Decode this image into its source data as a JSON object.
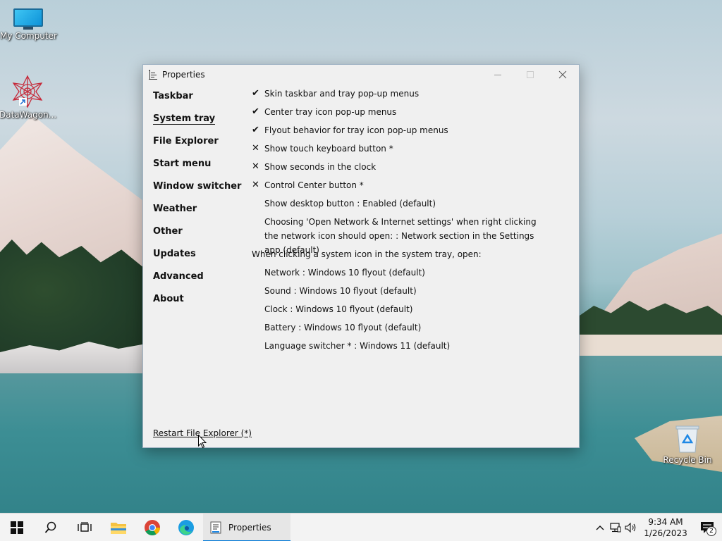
{
  "desktop": {
    "icons": [
      {
        "label": "My Computer"
      },
      {
        "label": "DataWagon..."
      },
      {
        "label": "Recycle Bin"
      }
    ]
  },
  "window": {
    "title": "Properties",
    "nav": [
      "Taskbar",
      "System tray",
      "File Explorer",
      "Start menu",
      "Window switcher",
      "Weather",
      "Other",
      "Updates",
      "Advanced",
      "About"
    ],
    "active_nav": "System tray",
    "options": [
      {
        "mark": "✔",
        "text": "Skin taskbar and tray pop-up menus"
      },
      {
        "mark": "✔",
        "text": "Center tray icon pop-up menus"
      },
      {
        "mark": "✔",
        "text": "Flyout behavior for tray icon pop-up menus"
      },
      {
        "mark": "✕",
        "text": "Show touch keyboard button *"
      },
      {
        "mark": "✕",
        "text": "Show seconds in the clock"
      },
      {
        "mark": "✕",
        "text": "Control Center button *"
      },
      {
        "mark": "",
        "text": "Show desktop button : Enabled (default)"
      },
      {
        "mark": "",
        "text": "Choosing 'Open Network & Internet settings' when right clicking the network icon should open: : Network section in the Settings app (default)"
      }
    ],
    "system_icon_header": "When clicking a system icon in the system tray, open:",
    "system_icon_options": [
      "Network : Windows 10 flyout (default)",
      "Sound : Windows 10 flyout (default)",
      "Clock : Windows 10 flyout (default)",
      "Battery : Windows 10 flyout (default)",
      "Language switcher * : Windows 11 (default)"
    ],
    "restart_link": "Restart File Explorer (*)"
  },
  "taskbar": {
    "app_label": "Properties",
    "time": "9:34 AM",
    "date": "1/26/2023",
    "notification_count": "2"
  },
  "colors": {
    "accent": "#0078d7",
    "window_bg": "#f0f0f0",
    "taskbar_bg": "#f3f3f3"
  }
}
